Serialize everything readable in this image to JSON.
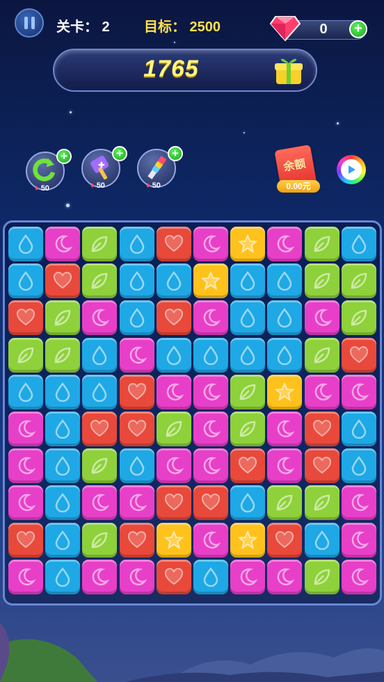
{
  "header": {
    "level_text": "关卡： 2",
    "target_text": "目标： 2500",
    "gems": "0"
  },
  "score": "1765",
  "boosters": [
    {
      "name": "refresh",
      "cost": "50"
    },
    {
      "name": "hammer",
      "cost": "50"
    },
    {
      "name": "brush",
      "cost": "50"
    }
  ],
  "redpack": {
    "title": "余额",
    "balance": "0.00元"
  },
  "colors": {
    "blue": "#1fa8e6",
    "magenta": "#e83fc8",
    "green": "#8ed13a",
    "red": "#e8493a",
    "yellow": "#ffc21c"
  },
  "board": {
    "cols": 10,
    "rows": 10,
    "grid": [
      [
        "B",
        "M",
        "G",
        "B",
        "R",
        "M",
        "Y",
        "M",
        "G",
        "B"
      ],
      [
        "B",
        "R",
        "G",
        "B",
        "B",
        "Y",
        "B",
        "B",
        "G",
        "G"
      ],
      [
        "R",
        "G",
        "M",
        "B",
        "R",
        "M",
        "B",
        "B",
        "M",
        "G"
      ],
      [
        "G",
        "G",
        "B",
        "M",
        "B",
        "B",
        "B",
        "B",
        "G",
        "R"
      ],
      [
        "B",
        "B",
        "B",
        "R",
        "M",
        "M",
        "G",
        "Y",
        "M",
        "M"
      ],
      [
        "M",
        "B",
        "R",
        "R",
        "G",
        "M",
        "G",
        "M",
        "R",
        "B"
      ],
      [
        "M",
        "B",
        "G",
        "B",
        "M",
        "M",
        "R",
        "M",
        "R",
        "B"
      ],
      [
        "M",
        "B",
        "M",
        "M",
        "R",
        "R",
        "B",
        "G",
        "G",
        "M"
      ],
      [
        "R",
        "B",
        "G",
        "R",
        "Y",
        "M",
        "Y",
        "R",
        "B",
        "M"
      ],
      [
        "M",
        "B",
        "M",
        "M",
        "R",
        "B",
        "M",
        "M",
        "G",
        "M"
      ]
    ]
  }
}
